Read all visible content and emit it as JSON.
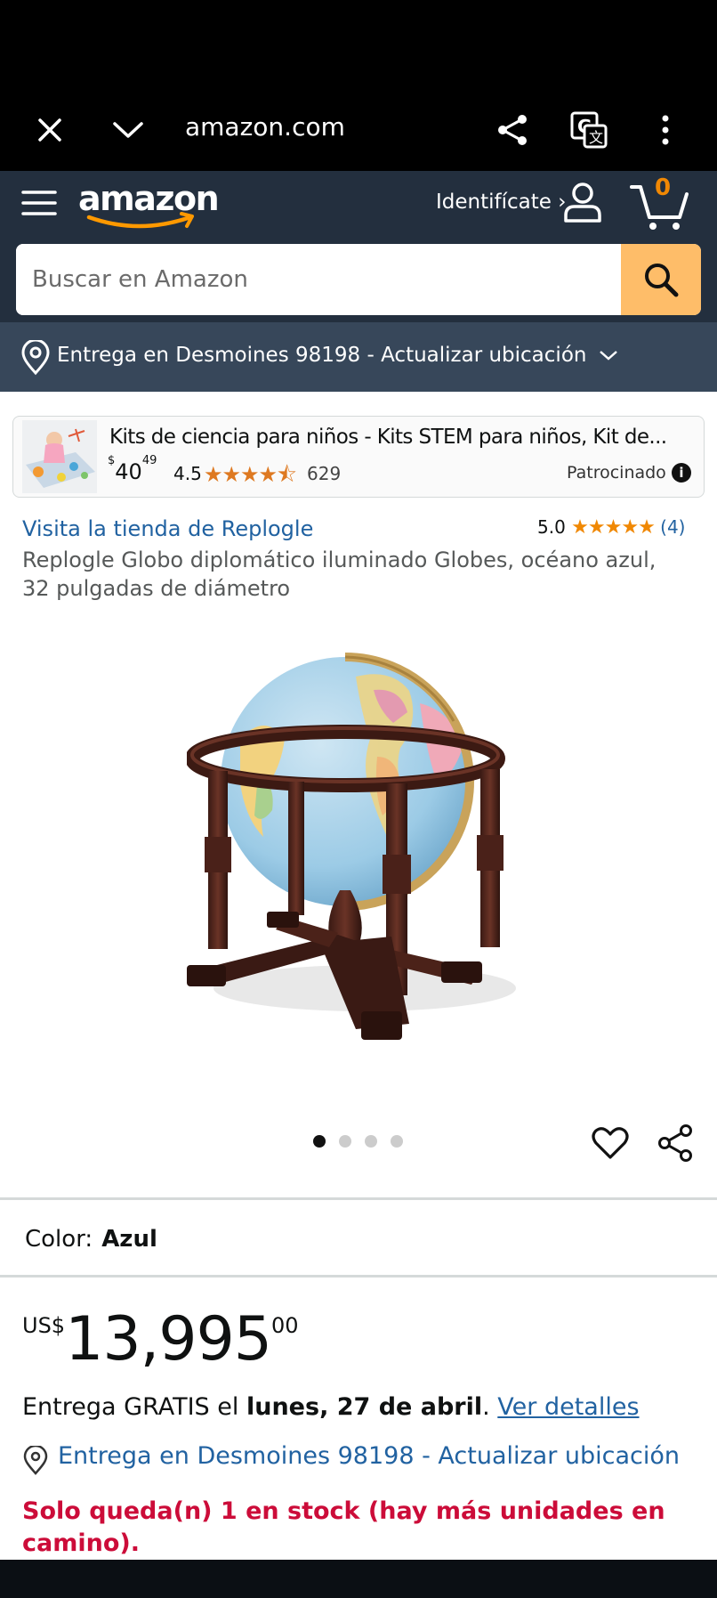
{
  "browser": {
    "url": "amazon.com"
  },
  "header": {
    "signin_label": "Identifícate ›",
    "cart_count": "0"
  },
  "search": {
    "placeholder": "Buscar en Amazon"
  },
  "delivery_bar": {
    "text": "Entrega en Desmoines 98198 - Actualizar ubicación"
  },
  "ad": {
    "title": "Kits de ciencia para niños - Kits STEM para niños, Kit de...",
    "price_currency": "$",
    "price_whole": "40",
    "price_fraction": "49",
    "rating": "4.5",
    "stars": "★★★★⯪",
    "review_count": "629",
    "sponsored_label": "Patrocinado",
    "info_icon": "i"
  },
  "product": {
    "store_link": "Visita la tienda de Replogle",
    "rating": "5.0",
    "stars": "★★★★★",
    "rating_count": "(4)",
    "title": "Replogle Globo diplomático iluminado Globes, océano azul, 32 pulgadas de diámetro",
    "image_count": 4,
    "active_image": 1,
    "color_label": "Color:",
    "color_value": "Azul",
    "price_currency": "US$",
    "price_whole": "13,995",
    "price_fraction": "00",
    "delivery_prefix": "Entrega GRATIS el ",
    "delivery_date": "lunes, 27 de abril",
    "delivery_suffix": ". ",
    "delivery_details_link": "Ver detalles",
    "delivery_location": "Entrega en Desmoines 98198 - Actualizar ubicación",
    "stock_message": "Solo queda(n) 1 en stock (hay más unidades en camino)."
  },
  "colors": {
    "header_bg": "#232f3e",
    "delivery_bar_bg": "#37475a",
    "search_button": "#febd69",
    "link": "#2162a1",
    "star": "#f08804",
    "stock_red": "#cc0c39"
  }
}
